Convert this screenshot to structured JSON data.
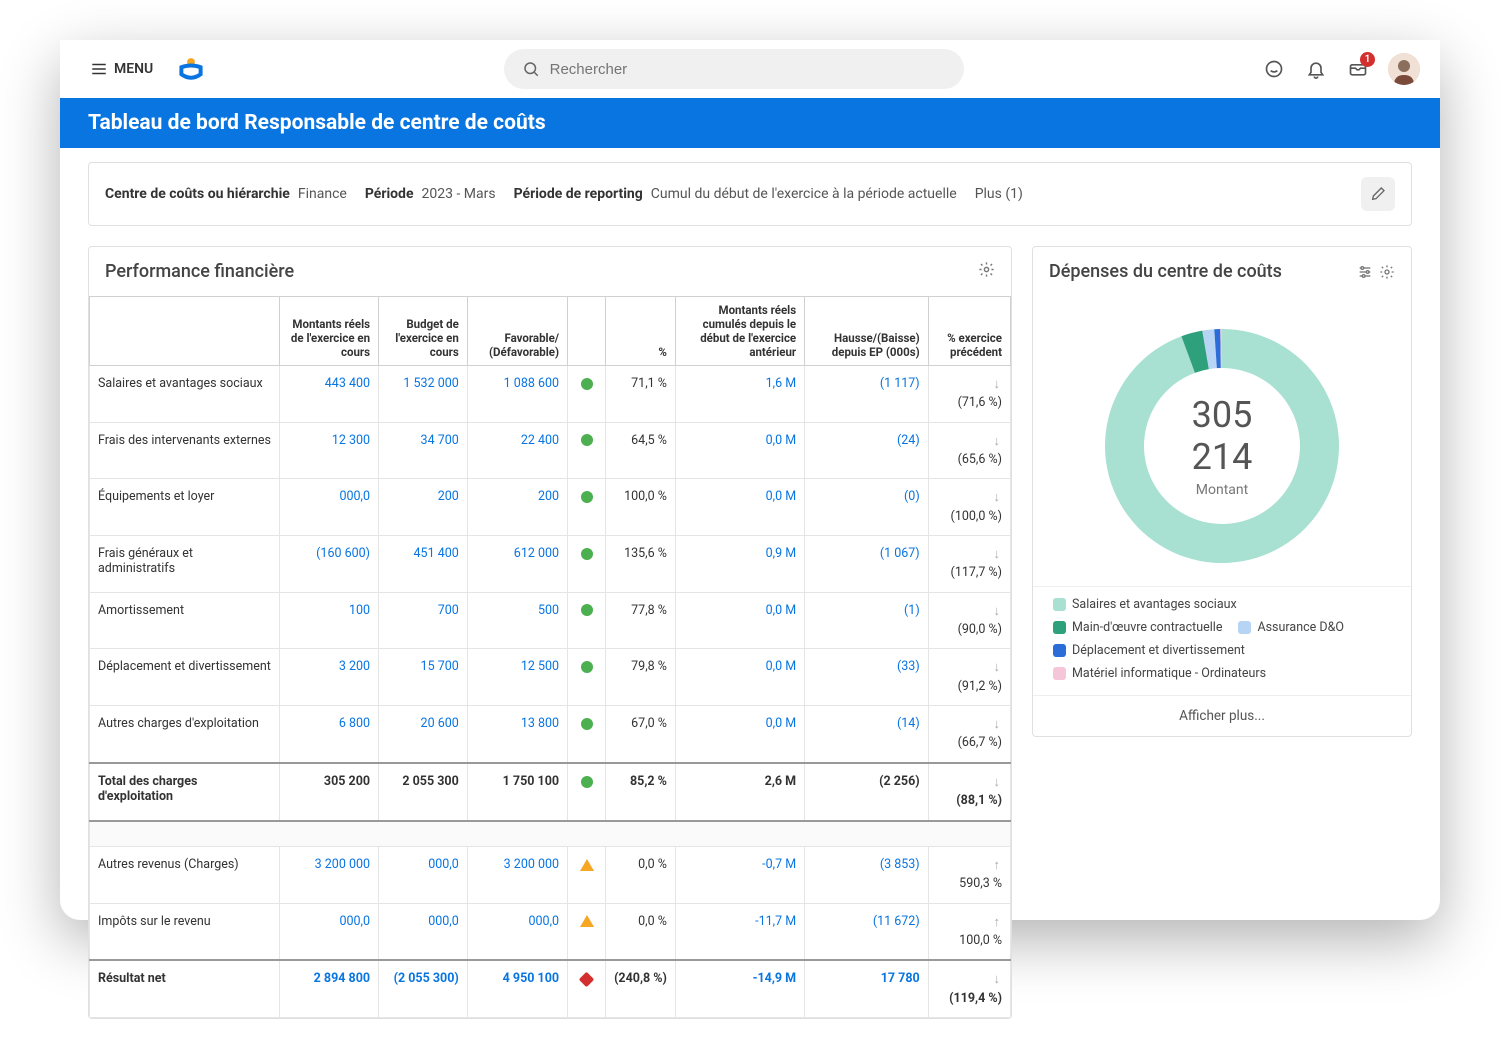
{
  "header": {
    "menu": "MENU",
    "search_placeholder": "Rechercher",
    "inbox_badge": "1"
  },
  "title": "Tableau de bord Responsable de centre de coûts",
  "filters": {
    "f1_label": "Centre de coûts ou hiérarchie",
    "f1_value": "Finance",
    "f2_label": "Période",
    "f2_value": "2023 - Mars",
    "f3_label": "Période de reporting",
    "f3_value": "Cumul du début de l'exercice à la période actuelle",
    "more": "Plus (1)"
  },
  "table": {
    "title": "Performance financière",
    "headers": {
      "c0": "",
      "c1": "Montants réels de l'exercice en cours",
      "c2": "Budget de l'exercice en cours",
      "c3": "Favorable/ (Défavorable)",
      "c4": "%",
      "c5": "Montants réels cumulés depuis le début de l'exercice antérieur",
      "c6": "Hausse/(Baisse) depuis EP (000s)",
      "c7": "% exercice précédent"
    },
    "rows": [
      {
        "name": "Salaires et avantages sociaux",
        "actual": "443 400",
        "budget": "1 532 000",
        "fav": "1 088 600",
        "dot": "green",
        "pct": "71,1 %",
        "prior": "1,6 M",
        "delta": "(1 117)",
        "arrow": "↓",
        "ppct": "(71,6 %)"
      },
      {
        "name": "Frais des intervenants externes",
        "actual": "12 300",
        "budget": "34 700",
        "fav": "22 400",
        "dot": "green",
        "pct": "64,5 %",
        "prior": "0,0 M",
        "delta": "(24)",
        "arrow": "↓",
        "ppct": "(65,6 %)"
      },
      {
        "name": "Équipements et loyer",
        "actual": "000,0",
        "budget": "200",
        "fav": "200",
        "dot": "green",
        "pct": "100,0 %",
        "prior": "0,0 M",
        "delta": "(0)",
        "arrow": "↓",
        "ppct": "(100,0 %)"
      },
      {
        "name": "Frais généraux et administratifs",
        "actual": "(160 600)",
        "budget": "451 400",
        "fav": "612 000",
        "dot": "green",
        "pct": "135,6 %",
        "prior": "0,9 M",
        "delta": "(1 067)",
        "arrow": "↓",
        "ppct": "(117,7 %)"
      },
      {
        "name": "Amortissement",
        "actual": "100",
        "budget": "700",
        "fav": "500",
        "dot": "green",
        "pct": "77,8 %",
        "prior": "0,0 M",
        "delta": "(1)",
        "arrow": "↓",
        "ppct": "(90,0 %)"
      },
      {
        "name": "Déplacement et divertissement",
        "actual": "3 200",
        "budget": "15 700",
        "fav": "12 500",
        "dot": "green",
        "pct": "79,8 %",
        "prior": "0,0 M",
        "delta": "(33)",
        "arrow": "↓",
        "ppct": "(91,2 %)"
      },
      {
        "name": "Autres charges d'exploitation",
        "actual": "6 800",
        "budget": "20 600",
        "fav": "13 800",
        "dot": "green",
        "pct": "67,0 %",
        "prior": "0,0 M",
        "delta": "(14)",
        "arrow": "↓",
        "ppct": "(66,7 %)"
      }
    ],
    "total": {
      "name": "Total des charges d'exploitation",
      "actual": "305 200",
      "budget": "2 055 300",
      "fav": "1 750 100",
      "dot": "green",
      "pct": "85,2 %",
      "prior": "2,6 M",
      "delta": "(2 256)",
      "arrow": "↓",
      "ppct": "(88,1 %)"
    },
    "rows2": [
      {
        "name": "Autres revenus (Charges)",
        "actual": "3 200 000",
        "budget": "000,0",
        "fav": "3 200 000",
        "dot": "yellow",
        "pct": "0,0 %",
        "prior": "-0,7 M",
        "delta": "(3 853)",
        "arrow": "↑",
        "ppct": "590,3 %"
      },
      {
        "name": "Impôts sur le revenu",
        "actual": "000,0",
        "budget": "000,0",
        "fav": "000,0",
        "dot": "yellow",
        "pct": "0,0 %",
        "prior": "-11,7 M",
        "delta": "(11 672)",
        "arrow": "↑",
        "ppct": "100,0 %"
      }
    ],
    "net": {
      "name": "Résultat net",
      "actual": "2 894 800",
      "budget": "(2 055 300)",
      "fav": "4 950 100",
      "dot": "red",
      "pct": "(240,8 %)",
      "prior": "-14,9 M",
      "delta": "17 780",
      "arrow": "↓",
      "ppct": "(119,4 %)"
    }
  },
  "donut": {
    "title": "Dépenses du centre de coûts",
    "center_value": "305 214",
    "center_label": "Montant",
    "legend": [
      {
        "label": "Salaires et avantages sociaux",
        "color": "#a8e0d1"
      },
      {
        "label": "Main-d'œuvre contractuelle",
        "color": "#2ea07c"
      },
      {
        "label": "Assurance D&O",
        "color": "#b8d4f5"
      },
      {
        "label": "Déplacement et divertissement",
        "color": "#2a6dd9"
      },
      {
        "label": "Matériel informatique - Ordinateurs",
        "color": "#f5c6d8"
      }
    ],
    "showmore": "Afficher plus..."
  },
  "chart_data": {
    "type": "pie",
    "title": "Dépenses du centre de coûts",
    "total": 305214,
    "series": [
      {
        "name": "Salaires et avantages sociaux",
        "value": 288000,
        "color": "#a8e0d1"
      },
      {
        "name": "Main-d'œuvre contractuelle",
        "value": 9000,
        "color": "#2ea07c"
      },
      {
        "name": "Assurance D&O",
        "value": 5000,
        "color": "#b8d4f5"
      },
      {
        "name": "Déplacement et divertissement",
        "value": 2500,
        "color": "#2a6dd9"
      },
      {
        "name": "Matériel informatique - Ordinateurs",
        "value": 714,
        "color": "#f5c6d8"
      }
    ]
  }
}
